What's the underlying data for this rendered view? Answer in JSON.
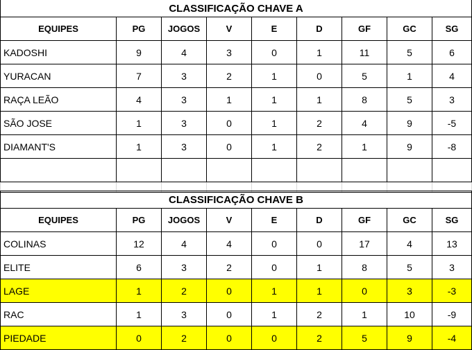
{
  "group_a": {
    "title": "CLASSIFICAÇÃO CHAVE A",
    "headers": [
      "EQUIPES",
      "PG",
      "JOGOS",
      "V",
      "E",
      "D",
      "GF",
      "GC",
      "SG"
    ],
    "rows": [
      {
        "team": "KADOSHI",
        "pg": "9",
        "jogos": "4",
        "v": "3",
        "e": "0",
        "d": "1",
        "gf": "11",
        "gc": "5",
        "sg": "6"
      },
      {
        "team": "YURACAN",
        "pg": "7",
        "jogos": "3",
        "v": "2",
        "e": "1",
        "d": "0",
        "gf": "5",
        "gc": "1",
        "sg": "4"
      },
      {
        "team": "RAÇA LEÃO",
        "pg": "4",
        "jogos": "3",
        "v": "1",
        "e": "1",
        "d": "1",
        "gf": "8",
        "gc": "5",
        "sg": "3"
      },
      {
        "team": "SÃO JOSE",
        "pg": "1",
        "jogos": "3",
        "v": "0",
        "e": "1",
        "d": "2",
        "gf": "4",
        "gc": "9",
        "sg": "-5"
      },
      {
        "team": "DIAMANT'S",
        "pg": "1",
        "jogos": "3",
        "v": "0",
        "e": "1",
        "d": "2",
        "gf": "1",
        "gc": "9",
        "sg": "-8"
      }
    ]
  },
  "group_b": {
    "title": "CLASSIFICAÇÃO CHAVE B",
    "headers": [
      "EQUIPES",
      "PG",
      "JOGOS",
      "V",
      "E",
      "D",
      "GF",
      "GC",
      "SG"
    ],
    "highlight_color": "#ffff00",
    "rows": [
      {
        "team": "COLINAS",
        "pg": "12",
        "jogos": "4",
        "v": "4",
        "e": "0",
        "d": "0",
        "gf": "17",
        "gc": "4",
        "sg": "13"
      },
      {
        "team": "ELITE",
        "pg": "6",
        "jogos": "3",
        "v": "2",
        "e": "0",
        "d": "1",
        "gf": "8",
        "gc": "5",
        "sg": "3"
      },
      {
        "team": "LAGE",
        "pg": "1",
        "jogos": "2",
        "v": "0",
        "e": "1",
        "d": "1",
        "gf": "0",
        "gc": "3",
        "sg": "-3",
        "highlighted": true
      },
      {
        "team": "RAC",
        "pg": "1",
        "jogos": "3",
        "v": "0",
        "e": "1",
        "d": "2",
        "gf": "1",
        "gc": "10",
        "sg": "-9"
      },
      {
        "team": "PIEDADE",
        "pg": "0",
        "jogos": "2",
        "v": "0",
        "e": "0",
        "d": "2",
        "gf": "5",
        "gc": "9",
        "sg": "-4",
        "highlighted": true
      }
    ]
  }
}
